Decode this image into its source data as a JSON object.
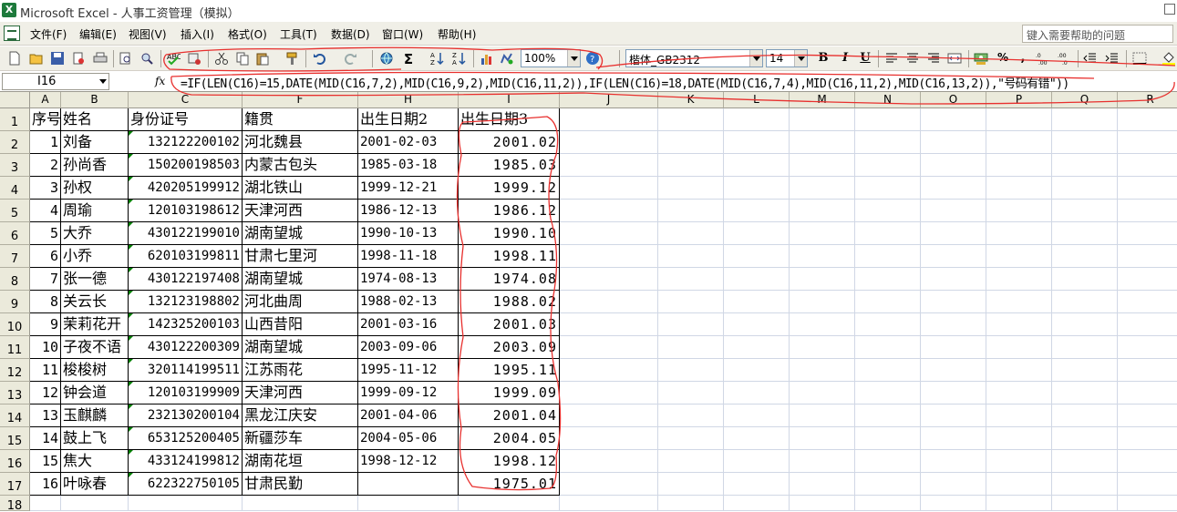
{
  "window": {
    "title": "Microsoft Excel - 人事工资管理（模拟）",
    "app_icon_letter": "X"
  },
  "menu": {
    "items": [
      "文件(F)",
      "编辑(E)",
      "视图(V)",
      "插入(I)",
      "格式(O)",
      "工具(T)",
      "数据(D)",
      "窗口(W)",
      "帮助(H)"
    ],
    "help_placeholder": "键入需要帮助的问题"
  },
  "toolbar": {
    "zoom": "100%",
    "font_name": "楷体_GB2312",
    "font_size": "14",
    "sigma": "Σ",
    "bold": "B",
    "italic": "I",
    "underline": "U",
    "percent": "%",
    "comma": ","
  },
  "formula_bar": {
    "name_box": "I16",
    "fx": "fx",
    "formula": "=IF(LEN(C16)=15,DATE(MID(C16,7,2),MID(C16,9,2),MID(C16,11,2)),IF(LEN(C16)=18,DATE(MID(C16,7,4),MID(C16,11,2),MID(C16,13,2)),\"号码有错\"))"
  },
  "columns": [
    "A",
    "B",
    "C",
    "F",
    "H",
    "I",
    "J",
    "K",
    "L",
    "M",
    "N",
    "O",
    "P",
    "Q",
    "R"
  ],
  "rows": [
    "1",
    "2",
    "3",
    "4",
    "5",
    "6",
    "7",
    "8",
    "9",
    "10",
    "11",
    "12",
    "13",
    "14",
    "15",
    "16",
    "17",
    "18"
  ],
  "headers": {
    "a": "序号",
    "b": "姓名",
    "c": "身份证号",
    "f": "籍贯",
    "h": "出生日期2",
    "i": "出生日期3"
  },
  "records": [
    {
      "a": "1",
      "b": "刘备",
      "c": "132122200102",
      "f": "河北魏县",
      "h": "2001-02-03",
      "i": "2001.02"
    },
    {
      "a": "2",
      "b": "孙尚香",
      "c": "150200198503",
      "f": "内蒙古包头",
      "h": "1985-03-18",
      "i": "1985.03"
    },
    {
      "a": "3",
      "b": "孙权",
      "c": "420205199912",
      "f": "湖北铁山",
      "h": "1999-12-21",
      "i": "1999.12"
    },
    {
      "a": "4",
      "b": "周瑜",
      "c": "120103198612",
      "f": "天津河西",
      "h": "1986-12-13",
      "i": "1986.12"
    },
    {
      "a": "5",
      "b": "大乔",
      "c": "430122199010",
      "f": "湖南望城",
      "h": "1990-10-13",
      "i": "1990.10"
    },
    {
      "a": "6",
      "b": "小乔",
      "c": "620103199811",
      "f": "甘肃七里河",
      "h": "1998-11-18",
      "i": "1998.11"
    },
    {
      "a": "7",
      "b": "张一德",
      "c": "430122197408",
      "f": "湖南望城",
      "h": "1974-08-13",
      "i": "1974.08"
    },
    {
      "a": "8",
      "b": "关云长",
      "c": "132123198802",
      "f": "河北曲周",
      "h": "1988-02-13",
      "i": "1988.02"
    },
    {
      "a": "9",
      "b": "茉莉花开",
      "c": "142325200103",
      "f": "山西昔阳",
      "h": "2001-03-16",
      "i": "2001.03"
    },
    {
      "a": "10",
      "b": "子夜不语",
      "c": "430122200309",
      "f": "湖南望城",
      "h": "2003-09-06",
      "i": "2003.09"
    },
    {
      "a": "11",
      "b": "梭梭树",
      "c": "320114199511",
      "f": "江苏雨花",
      "h": "1995-11-12",
      "i": "1995.11"
    },
    {
      "a": "12",
      "b": "钟会道",
      "c": "120103199909",
      "f": "天津河西",
      "h": "1999-09-12",
      "i": "1999.09"
    },
    {
      "a": "13",
      "b": "玉麒麟",
      "c": "232130200104",
      "f": "黑龙江庆安",
      "h": "2001-04-06",
      "i": "2001.04"
    },
    {
      "a": "14",
      "b": "鼓上飞",
      "c": "653125200405",
      "f": "新疆莎车",
      "h": "2004-05-06",
      "i": "2004.05"
    },
    {
      "a": "15",
      "b": "焦大",
      "c": "433124199812",
      "f": "湖南花垣",
      "h": "1998-12-12",
      "i": "1998.12"
    },
    {
      "a": "16",
      "b": "叶咏春",
      "c": "622322750105",
      "f": "甘肃民勤",
      "h": "",
      "i": "1975.01"
    }
  ],
  "annotation_color": "#e8302e",
  "icons": [
    "excel-app-icon",
    "new-icon",
    "open-icon",
    "save-icon",
    "permission-icon",
    "print-icon",
    "print-preview-icon",
    "spelling-icon",
    "research-icon",
    "cut-icon",
    "copy-icon",
    "paste-icon",
    "format-painter-icon",
    "undo-icon",
    "redo-icon",
    "hyperlink-icon",
    "autosum-icon",
    "sort-ascending-icon",
    "sort-descending-icon",
    "chart-wizard-icon",
    "drawing-icon",
    "help-icon",
    "align-left-icon",
    "center-icon",
    "align-right-icon",
    "merge-center-icon",
    "currency-icon",
    "percent-icon",
    "comma-icon",
    "increase-decimal-icon",
    "decrease-decimal-icon",
    "decrease-indent-icon",
    "increase-indent-icon",
    "borders-icon",
    "fill-color-icon"
  ]
}
